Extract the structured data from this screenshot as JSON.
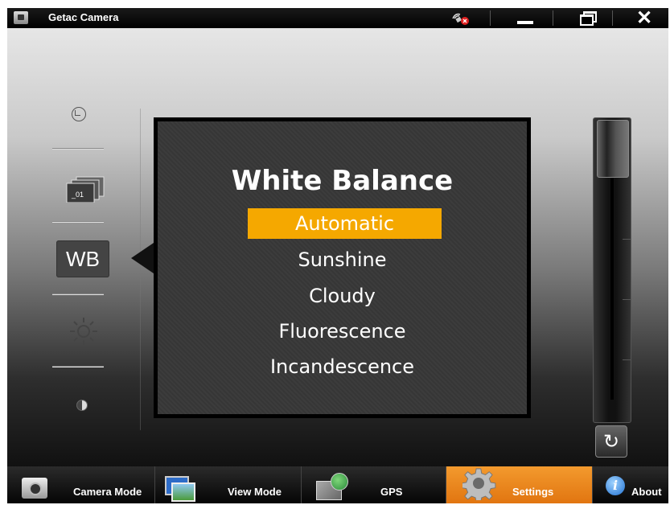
{
  "window": {
    "title": "Getac Camera",
    "app_icon": "camera-app-icon",
    "gps_status_icon": "gps-disabled-icon",
    "minimize_icon": "minimize-icon",
    "maximize_icon": "restore-icon",
    "close_glyph": "✕"
  },
  "left_toolbar": {
    "items": [
      {
        "name": "self-timer",
        "icon": "timer-icon"
      },
      {
        "name": "burst",
        "icon": "burst-count-icon",
        "badge": "_01"
      },
      {
        "name": "white-balance",
        "icon": "wb-icon",
        "label": "WB",
        "selected": true
      },
      {
        "name": "brightness",
        "icon": "brightness-icon"
      },
      {
        "name": "contrast",
        "icon": "contrast-icon"
      }
    ]
  },
  "white_balance_panel": {
    "title": "White Balance",
    "options": [
      "Automatic",
      "Sunshine",
      "Cloudy",
      "Fluorescence",
      "Incandescence"
    ],
    "selected_option": "Automatic",
    "highlight_color": "#f5a800"
  },
  "zoom_slider": {
    "level": 0,
    "reset_icon": "refresh-icon",
    "reset_glyph": "↻"
  },
  "bottom_tabs": [
    {
      "label": "Camera Mode",
      "icon": "camera-icon",
      "active": false
    },
    {
      "label": "View Mode",
      "icon": "photos-icon",
      "active": false
    },
    {
      "label": "GPS",
      "icon": "gps-map-icon",
      "active": false
    },
    {
      "label": "Settings",
      "icon": "gear-icon",
      "active": true
    },
    {
      "label": "About",
      "icon": "info-icon",
      "active": false
    }
  ],
  "colors": {
    "accent_orange": "#f39a2e",
    "title_bar": "#000000",
    "popup_bg": "#3a3a3a"
  }
}
